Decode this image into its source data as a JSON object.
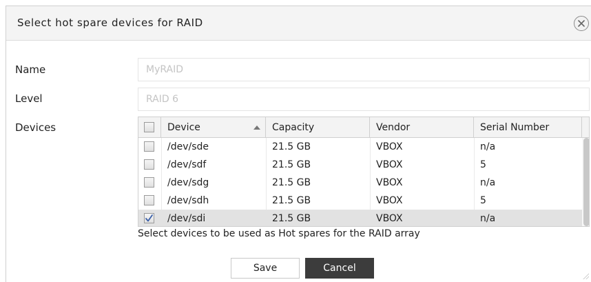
{
  "dialog": {
    "title": "Select hot spare devices for RAID",
    "close_icon": "close-icon"
  },
  "form": {
    "name_label": "Name",
    "name_value": "MyRAID",
    "level_label": "Level",
    "level_value": "RAID 6",
    "devices_label": "Devices"
  },
  "table": {
    "columns": [
      "Device",
      "Capacity",
      "Vendor",
      "Serial Number"
    ],
    "sort_column": "Device",
    "sort_direction": "ascending",
    "rows": [
      {
        "device": "/dev/sde",
        "capacity": "21.5 GB",
        "vendor": "VBOX",
        "serial": "n/a",
        "checked": false
      },
      {
        "device": "/dev/sdf",
        "capacity": "21.5 GB",
        "vendor": "VBOX",
        "serial": "5",
        "checked": false
      },
      {
        "device": "/dev/sdg",
        "capacity": "21.5 GB",
        "vendor": "VBOX",
        "serial": "n/a",
        "checked": false
      },
      {
        "device": "/dev/sdh",
        "capacity": "21.5 GB",
        "vendor": "VBOX",
        "serial": "5",
        "checked": false
      },
      {
        "device": "/dev/sdi",
        "capacity": "21.5 GB",
        "vendor": "VBOX",
        "serial": "n/a",
        "checked": true
      }
    ]
  },
  "hint": "Select devices to be used as Hot spares for the RAID array",
  "buttons": {
    "save_label": "Save",
    "cancel_label": "Cancel"
  },
  "colors": {
    "cancel_bg": "#3c3c3c",
    "checkmark": "#3a5fa8",
    "selected_row": "#e2e2e2"
  }
}
